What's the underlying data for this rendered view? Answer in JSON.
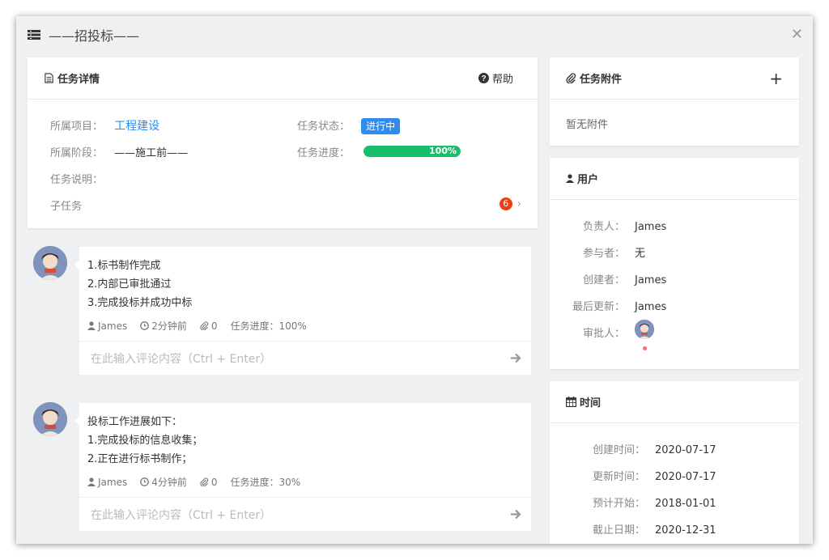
{
  "dialog": {
    "title": "——招投标——"
  },
  "task_detail": {
    "heading": "任务详情",
    "help_label": "帮助",
    "project_label": "所属项目：",
    "project_value": "工程建设",
    "stage_label": "所属阶段：",
    "stage_value": "——施工前——",
    "desc_label": "任务说明：",
    "status_label": "任务状态：",
    "status_value": "进行中",
    "progress_label": "任务进度：",
    "progress_value": "100%",
    "progress_fraction": 1.0,
    "subtask_label": "子任务",
    "subtask_count": "6"
  },
  "comments": [
    {
      "lines": [
        "1.标书制作完成",
        "2.内部已审批通过",
        "3.完成投标并成功中标"
      ],
      "author": "James",
      "time": "2分钟前",
      "attachments": "0",
      "progress": "任务进度：100%",
      "input_placeholder": "在此输入评论内容（Ctrl + Enter）"
    },
    {
      "lines": [
        "投标工作进展如下：",
        "1.完成投标的信息收集；",
        "2.正在进行标书制作；"
      ],
      "author": "James",
      "time": "4分钟前",
      "attachments": "0",
      "progress": "任务进度：30%",
      "input_placeholder": "在此输入评论内容（Ctrl + Enter）"
    }
  ],
  "attachments": {
    "heading": "任务附件",
    "empty_text": "暂无附件"
  },
  "users": {
    "heading": "用户",
    "owner_label": "负责人：",
    "owner_value": "James",
    "participants_label": "参与者：",
    "participants_value": "无",
    "creator_label": "创建者：",
    "creator_value": "James",
    "last_update_label": "最后更新：",
    "last_update_value": "James",
    "approver_label": "审批人："
  },
  "time": {
    "heading": "时间",
    "created_label": "创建时间：",
    "created_value": "2020-07-17",
    "updated_label": "更新时间：",
    "updated_value": "2020-07-17",
    "planned_start_label": "预计开始：",
    "planned_start_value": "2018-01-01",
    "deadline_label": "截止日期：",
    "deadline_value": "2020-12-31"
  },
  "colors": {
    "link": "#2d8cf0",
    "status_tag": "#2d8cf0",
    "progress": "#19be6b",
    "badge": "#ed4014"
  }
}
